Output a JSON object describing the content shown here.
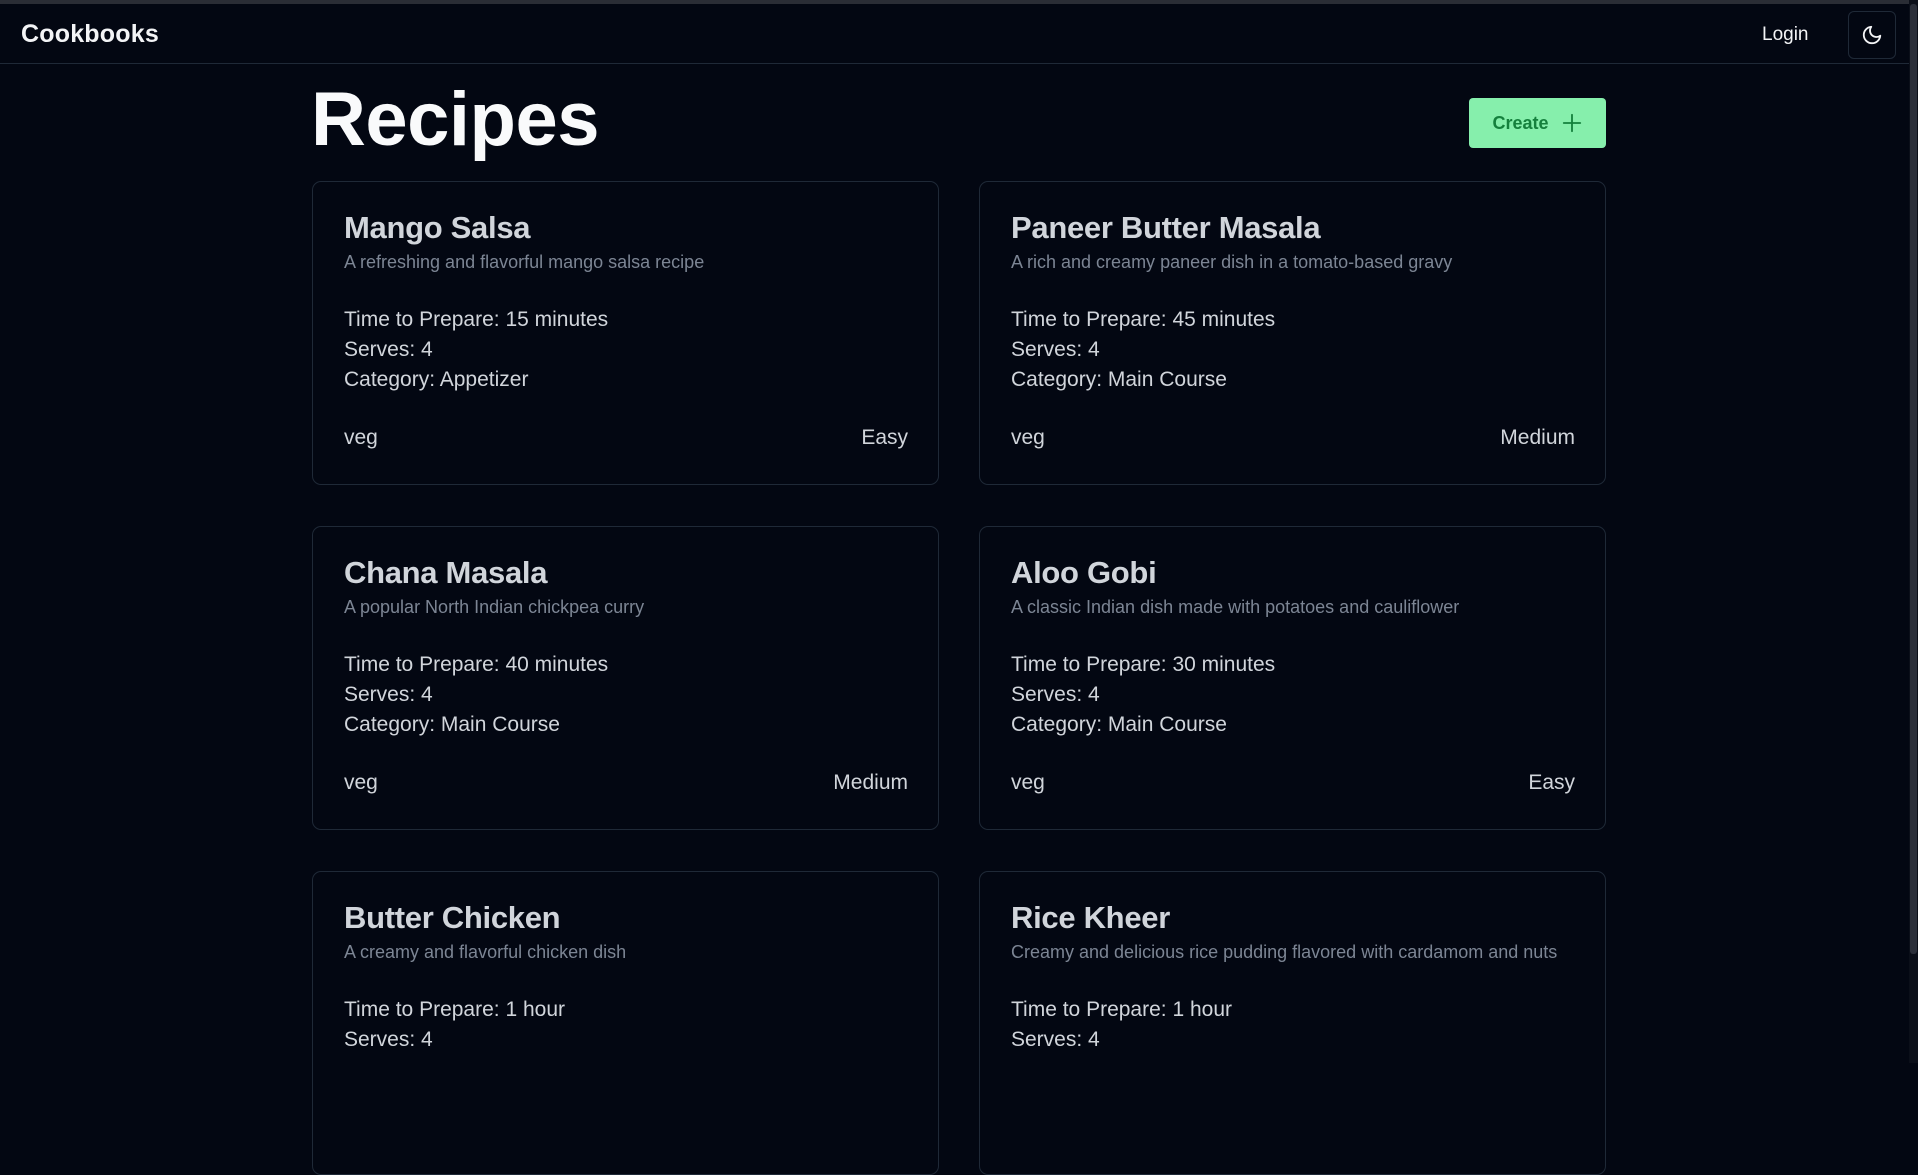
{
  "navbar": {
    "brand": "Cookbooks",
    "login_label": "Login",
    "theme_icon": "moon-icon"
  },
  "main": {
    "title": "Recipes",
    "create_label": "Create",
    "create_icon": "plus-icon"
  },
  "colors": {
    "background": "#030712",
    "accent": "#86efac",
    "accent_text": "#15803d",
    "border": "#1f2937"
  },
  "recipes": [
    {
      "title": "Mango Salsa",
      "description": "A refreshing and flavorful mango salsa recipe",
      "time": "Time to Prepare: 15 minutes",
      "serves": "Serves: 4",
      "category": "Category: Appetizer",
      "diet": "veg",
      "difficulty": "Easy"
    },
    {
      "title": "Paneer Butter Masala",
      "description": "A rich and creamy paneer dish in a tomato-based gravy",
      "time": "Time to Prepare: 45 minutes",
      "serves": "Serves: 4",
      "category": "Category: Main Course",
      "diet": "veg",
      "difficulty": "Medium"
    },
    {
      "title": "Chana Masala",
      "description": "A popular North Indian chickpea curry",
      "time": "Time to Prepare: 40 minutes",
      "serves": "Serves: 4",
      "category": "Category: Main Course",
      "diet": "veg",
      "difficulty": "Medium"
    },
    {
      "title": "Aloo Gobi",
      "description": "A classic Indian dish made with potatoes and cauliflower",
      "time": "Time to Prepare: 30 minutes",
      "serves": "Serves: 4",
      "category": "Category: Main Course",
      "diet": "veg",
      "difficulty": "Easy"
    },
    {
      "title": "Butter Chicken",
      "description": "A creamy and flavorful chicken dish",
      "time": "Time to Prepare: 1 hour",
      "serves": "Serves: 4"
    },
    {
      "title": "Rice Kheer",
      "description": "Creamy and delicious rice pudding flavored with cardamom and nuts",
      "time": "Time to Prepare: 1 hour",
      "serves": "Serves: 4"
    }
  ]
}
